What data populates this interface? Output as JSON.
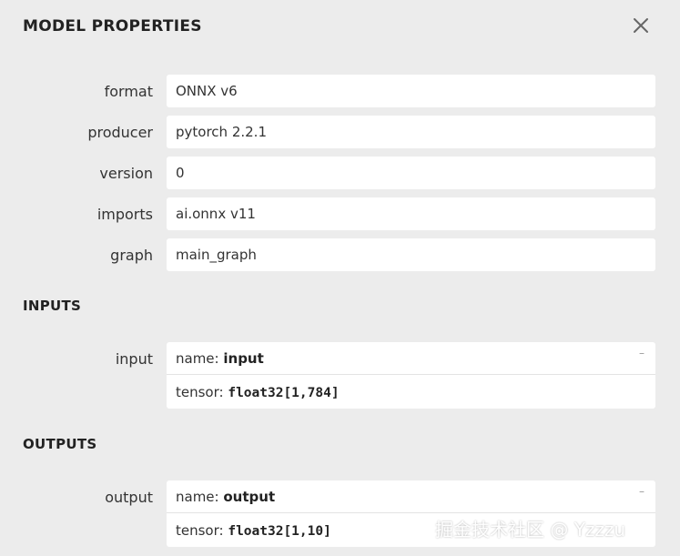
{
  "dialog": {
    "title": "MODEL PROPERTIES"
  },
  "properties": [
    {
      "label": "format",
      "value": "ONNX v6"
    },
    {
      "label": "producer",
      "value": "pytorch 2.2.1"
    },
    {
      "label": "version",
      "value": "0"
    },
    {
      "label": "imports",
      "value": "ai.onnx v11"
    },
    {
      "label": "graph",
      "value": "main_graph"
    }
  ],
  "inputs": {
    "section_title": "INPUTS",
    "items": [
      {
        "label": "input",
        "name_prefix": "name: ",
        "name": "input",
        "tensor_prefix": "tensor: ",
        "tensor": "float32[1,784]",
        "toggle": "–"
      }
    ]
  },
  "outputs": {
    "section_title": "OUTPUTS",
    "items": [
      {
        "label": "output",
        "name_prefix": "name: ",
        "name": "output",
        "tensor_prefix": "tensor: ",
        "tensor": "float32[1,10]",
        "toggle": "–"
      }
    ]
  },
  "watermark": "掘金技术社区 @ Yzzzu",
  "icons": {
    "close": "close-icon"
  }
}
